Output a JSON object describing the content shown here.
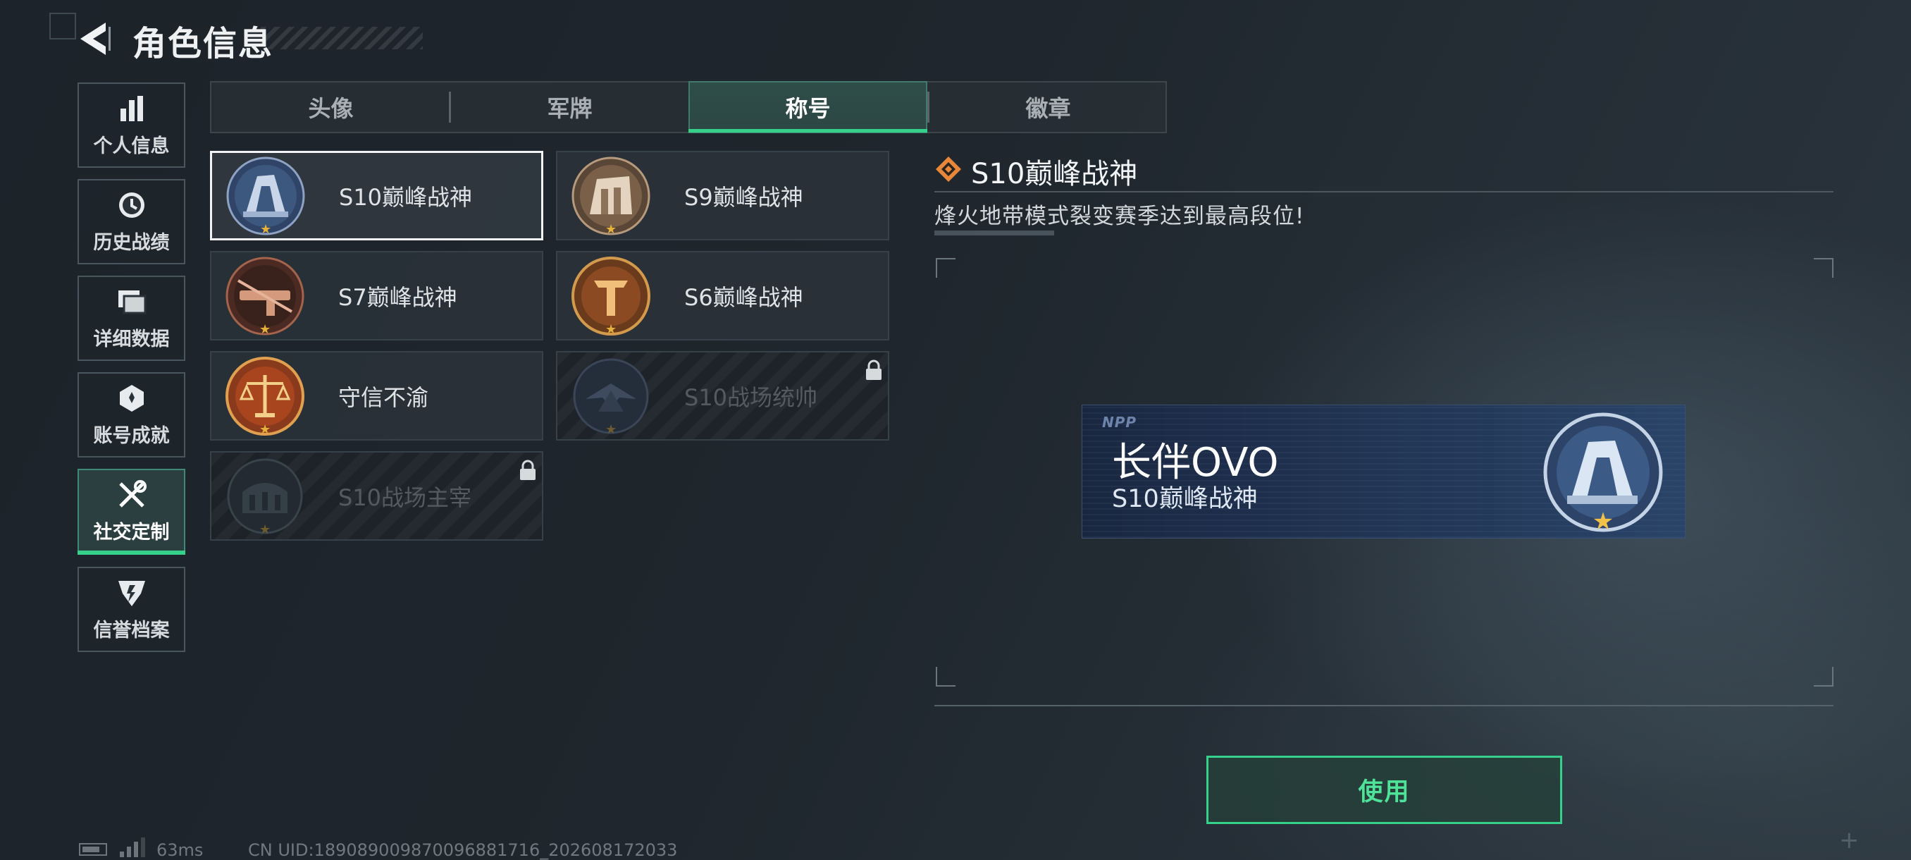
{
  "header": {
    "title": "角色信息"
  },
  "sidebar": {
    "items": [
      {
        "label": "个人信息",
        "icon": "bar-chart-icon"
      },
      {
        "label": "历史战绩",
        "icon": "clock-icon"
      },
      {
        "label": "详细数据",
        "icon": "folder-icon"
      },
      {
        "label": "账号成就",
        "icon": "achievement-icon"
      },
      {
        "label": "社交定制",
        "icon": "tools-icon",
        "active": true
      },
      {
        "label": "信誉档案",
        "icon": "credit-badge-icon"
      }
    ]
  },
  "tabs": [
    {
      "label": "头像"
    },
    {
      "label": "军牌"
    },
    {
      "label": "称号",
      "active": true
    },
    {
      "label": "徽章"
    }
  ],
  "titles": [
    {
      "name": "S10巅峰战神",
      "selected": true,
      "locked": false
    },
    {
      "name": "S9巅峰战神",
      "locked": false
    },
    {
      "name": "S7巅峰战神",
      "locked": false
    },
    {
      "name": "S6巅峰战神",
      "locked": false
    },
    {
      "name": "守信不渝",
      "locked": false
    },
    {
      "name": "S10战场统帅",
      "locked": true
    },
    {
      "name": "S10战场主宰",
      "locked": true
    }
  ],
  "detail": {
    "title": "S10巅峰战神",
    "description": "烽火地带模式裂变赛季达到最高段位!"
  },
  "preview": {
    "logo": "NPP",
    "player_name": "长伴OVO",
    "title": "S10巅峰战神"
  },
  "use_button": {
    "label": "使用"
  },
  "footer": {
    "ping": "63ms",
    "uid": "CN UID:18908900987009688171​6_202608172033"
  },
  "colors": {
    "accent": "#35d08a",
    "star": "#e6b13a"
  }
}
